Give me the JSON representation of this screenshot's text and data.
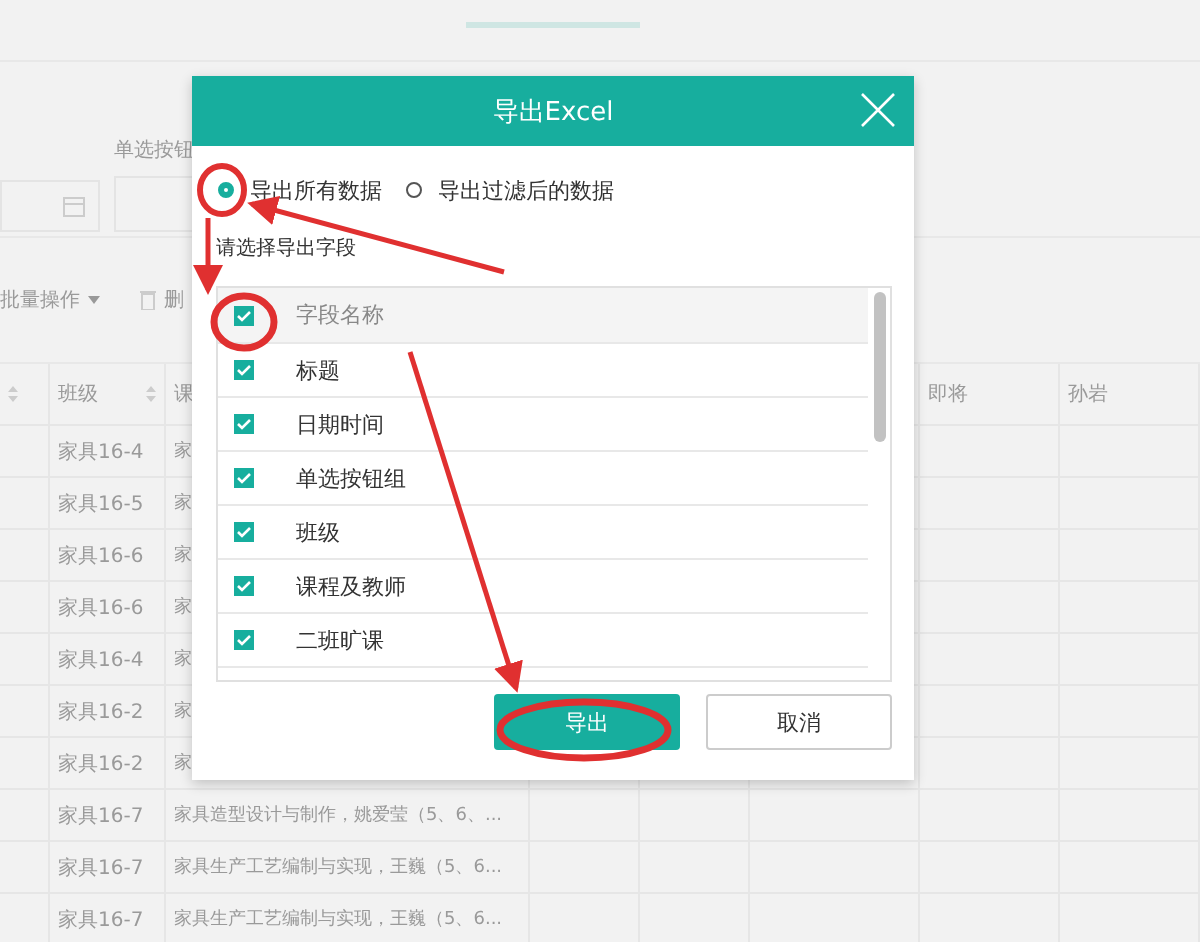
{
  "filter": {
    "label": "单选按钮"
  },
  "toolbar": {
    "batch": "批量操作",
    "delete": "删"
  },
  "table": {
    "columns": [
      {
        "label": "班级"
      },
      {
        "label": "课"
      },
      {
        "label": "即将"
      },
      {
        "label": "孙岩"
      }
    ],
    "rows": [
      {
        "class": "家具16-4",
        "course": "家"
      },
      {
        "class": "家具16-5",
        "course": "家"
      },
      {
        "class": "家具16-6",
        "course": "家"
      },
      {
        "class": "家具16-6",
        "course": "家"
      },
      {
        "class": "家具16-4",
        "course": "家"
      },
      {
        "class": "家具16-2",
        "course": "家"
      },
      {
        "class": "家具16-2",
        "course": "家"
      },
      {
        "class": "家具16-7",
        "course": "家具造型设计与制作，姚爱莹（5、6、..."
      },
      {
        "class": "家具16-7",
        "course": "家具生产工艺编制与实现，王巍（5、6..."
      },
      {
        "class": "家具16-7",
        "course": "家具生产工艺编制与实现，王巍（5、6..."
      }
    ]
  },
  "dialog": {
    "title": "导出Excel",
    "options": [
      {
        "label": "导出所有数据",
        "selected": true
      },
      {
        "label": "导出过滤后的数据",
        "selected": false
      }
    ],
    "prompt": "请选择导出字段",
    "header": {
      "label": "字段名称",
      "checked": true
    },
    "fields": [
      {
        "label": "标题",
        "checked": true
      },
      {
        "label": "日期时间",
        "checked": true
      },
      {
        "label": "单选按钮组",
        "checked": true
      },
      {
        "label": "班级",
        "checked": true
      },
      {
        "label": "课程及教师",
        "checked": true
      },
      {
        "label": "二班旷课",
        "checked": true
      }
    ],
    "buttons": [
      {
        "label": "导出",
        "kind": "primary"
      },
      {
        "label": "取消",
        "kind": "secondary"
      }
    ]
  }
}
